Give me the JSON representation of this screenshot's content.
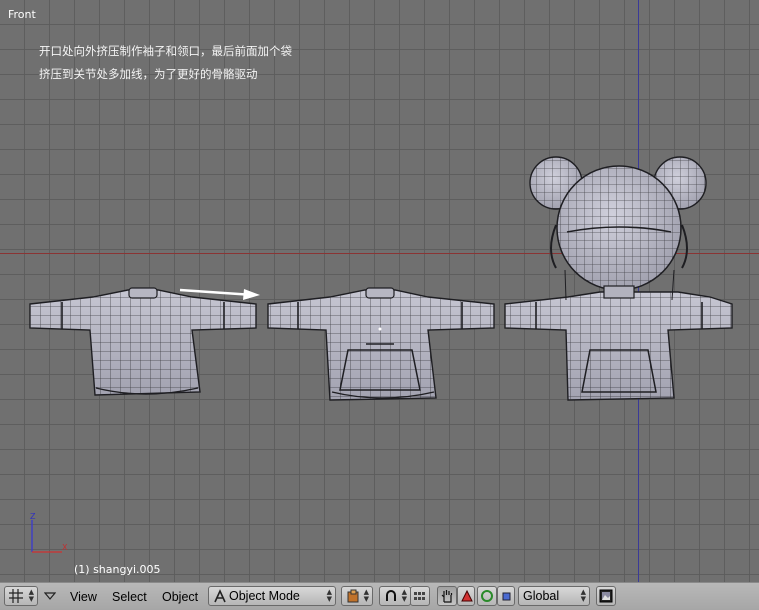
{
  "viewport": {
    "view_name": "Front",
    "annotation_line_1": "开口处向外挤压制作袖子和领口，最后前面加个袋",
    "annotation_line_2": "挤压到关节处多加线，为了更好的骨骼驱动",
    "object_info": "(1) shangyi.005",
    "gizmo": {
      "z_label": "Z",
      "x_label": "X"
    },
    "colors": {
      "background": "#707070",
      "grid": "#5c5c5c",
      "x_axis": "#8a3434",
      "z_axis": "#3a3a98",
      "mesh": "#b9b9c6",
      "wire": "#2a2a2a",
      "arrow": "#ffffff"
    },
    "meshes": [
      {
        "name": "sweater-stage-1",
        "icon": "sweater-mesh"
      },
      {
        "name": "sweater-stage-2",
        "icon": "sweater-mesh-with-pocket"
      },
      {
        "name": "character-with-sweater",
        "icon": "character-mesh"
      }
    ],
    "arrow_icon": "arrow-right"
  },
  "header": {
    "editor_type_icon": "grid-icon",
    "menu": {
      "view": "View",
      "select": "Select",
      "object": "Object"
    },
    "mode": {
      "label": "Object Mode",
      "icon": "object-mode-icon"
    },
    "draw_type_icon": "draw-type-icon",
    "pivot_icon": "pivot-icon",
    "layer_icon": "layers-icon",
    "manipulator_icons": [
      "hand-icon",
      "translate-icon",
      "rotate-icon",
      "scale-icon"
    ],
    "orientation": {
      "label": "Global"
    },
    "render_icon": "render-icon"
  }
}
